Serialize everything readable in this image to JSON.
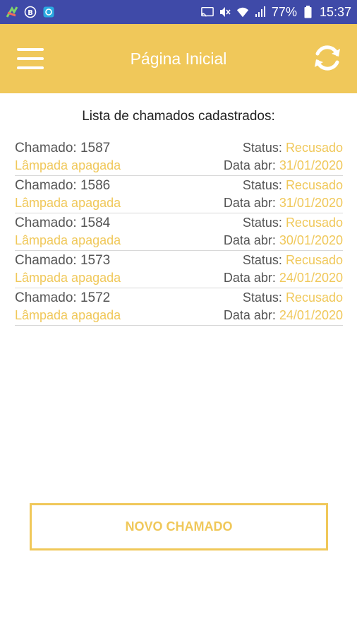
{
  "status_bar": {
    "battery": "77%",
    "time": "15:37",
    "icons": [
      "app-icon",
      "b-icon",
      "photo-icon",
      "cast-icon",
      "mute-icon",
      "wifi-icon",
      "signal-icon",
      "battery-icon"
    ]
  },
  "app_bar": {
    "title": "Página Inicial",
    "menu_icon": "hamburger-menu-icon",
    "refresh_icon": "refresh-icon"
  },
  "list": {
    "title": "Lista de chamados cadastrados:",
    "chamado_label": "Chamado: ",
    "status_label": "Status: ",
    "date_label": "Data abr: ",
    "items": [
      {
        "number": "1587",
        "description": "Lâmpada apagada",
        "status": "Recusado",
        "date": "31/01/2020"
      },
      {
        "number": "1586",
        "description": "Lâmpada apagada",
        "status": "Recusado",
        "date": "31/01/2020"
      },
      {
        "number": "1584",
        "description": "Lâmpada apagada",
        "status": "Recusado",
        "date": "30/01/2020"
      },
      {
        "number": "1573",
        "description": "Lâmpada apagada",
        "status": "Recusado",
        "date": "24/01/2020"
      },
      {
        "number": "1572",
        "description": "Lâmpada apagada",
        "status": "Recusado",
        "date": "24/01/2020"
      }
    ]
  },
  "new_button": {
    "label": "NOVO CHAMADO"
  },
  "colors": {
    "accent": "#f0c85a",
    "status_bar": "#3f4aa8"
  }
}
